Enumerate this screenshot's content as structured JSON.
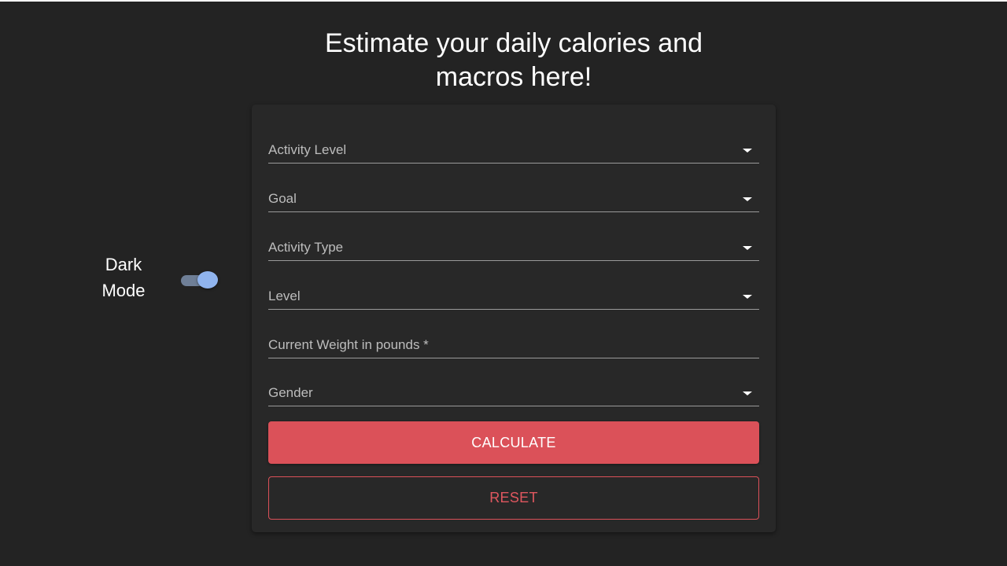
{
  "header": {
    "title_line1": "Estimate your daily calories and",
    "title_line2": "macros here!"
  },
  "dark_mode": {
    "label_line1": "Dark",
    "label_line2": "Mode",
    "enabled": true
  },
  "form": {
    "fields": [
      {
        "label": "Activity Level",
        "type": "select"
      },
      {
        "label": "Goal",
        "type": "select"
      },
      {
        "label": "Activity Type",
        "type": "select"
      },
      {
        "label": "Level",
        "type": "select"
      },
      {
        "label": "Current Weight in pounds *",
        "type": "text"
      },
      {
        "label": "Gender",
        "type": "select"
      }
    ],
    "calculate_label": "CALCULATE",
    "reset_label": "RESET"
  },
  "colors": {
    "background": "#232323",
    "card": "#282828",
    "accent": "#db5159",
    "toggle_thumb": "#90b4ee",
    "toggle_track": "#6f7f97"
  }
}
